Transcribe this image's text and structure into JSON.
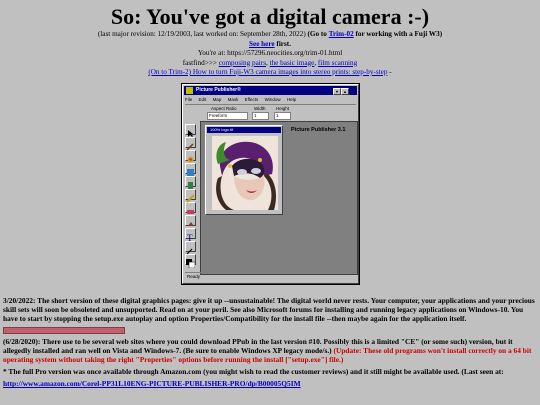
{
  "header": {
    "title": "So: You've got a digital camera :-)",
    "revision_prefix": "(last major revision: 12/19/2003, last worked on: September 28th, 2022)",
    "go_to_prefix": "(Go to",
    "go_to_link": "Trim-02",
    "go_to_suffix": "for working with a Fuji W3)",
    "see_here": "See here",
    "see_here_suffix": "first.",
    "you_are_at": "You're at: https://57296.neocities.org/trim-01.html",
    "fastfind_label": "fastfind>>>",
    "fastfind_links": [
      "composing pairs",
      "the basic image",
      "film scanning"
    ],
    "stereo_link": "(On to Trim-2) How to turn Fuji-W3 camera images into stereo prints: step-by-step",
    "stereo_suffix": "-"
  },
  "screenshot": {
    "app_title": "Picture Publisher®",
    "menu": [
      "File",
      "Edit",
      "Map",
      "Mask",
      "Effects",
      "Window",
      "Help"
    ],
    "toolbar": {
      "aspect_ratio_label": "Aspect Ratio",
      "aspect_ratio_value": "Freeform",
      "width_label": "Width",
      "width_value": "1",
      "height_label": "Height",
      "height_value": "1"
    },
    "doc_title": "100% logo.tif",
    "workspace_label": "Picture Publisher 3.1",
    "status": "Ready"
  },
  "body": {
    "p1": "3/20/2022: The short version of these digital graphics pages: give it up --unsustainable! The digital world never rests. Your computer, your applications and your precious skill sets will soon be obsoleted and unsupported. Read on at your peril. See also Microsoft forums for installing and running legacy applications on Windows-10. You have to start by stopping the setup.exe autoplay and option Properties/Compatibility for the install file --then maybe again for the application itself.",
    "p2_main": "(6/28/2020): There use to be several web sites where you could download PPub in the last version #10. Possibly this is a limited \"CE\" (or some such) version, but it allegedly installed and ran well on Vista and Windows-7. (Be sure to enable Windows XP legacy mode/s.)",
    "p2_update": "(Update: These old programs won't install correctly on a 64 bit operating system without taking the right \"Properties\" options before running the install [\"setup.exe\"] file.)",
    "p3": "* The full Pro version was once available through Amazon.com (you might wish to read the customer reviews) and it still might be available used. (Last seen at:",
    "amazon_link": "http://www.amazon.com/Corel-PP31L10ENG-PICTURE-PUBLISHER-PRO/dp/B00005Q5IM"
  },
  "colors": {
    "background": "#c0c0c0",
    "link": "#0000cc",
    "update_red": "#cc0000",
    "titlebar": "#000080"
  }
}
